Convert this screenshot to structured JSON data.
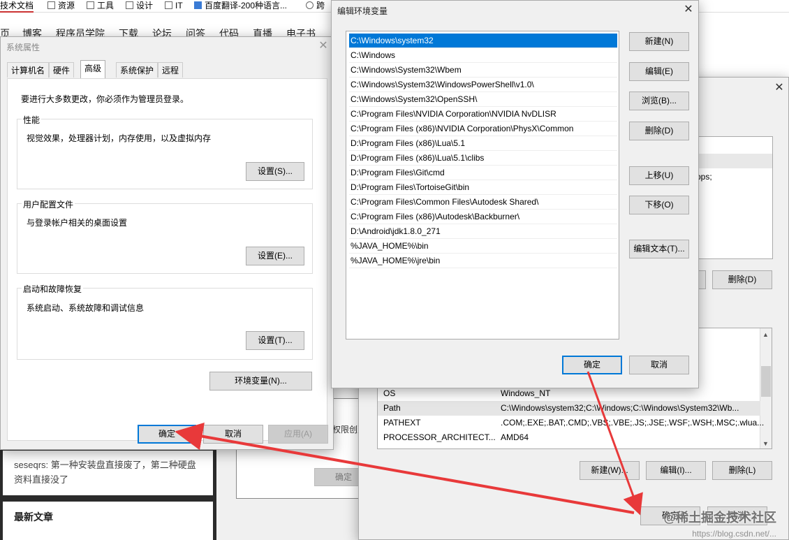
{
  "browser": {
    "bookmarks": [
      "技术文档",
      "资源",
      "工具",
      "设计",
      "IT",
      "百度翻译-200种语言...",
      "跨"
    ],
    "nav": [
      "页",
      "博客",
      "程序员学院",
      "下载",
      "论坛",
      "问答",
      "代码",
      "直播",
      "电子书"
    ],
    "comment": "seseqrs: 第一种安装盘直接废了，第二种硬盘资料直接没了",
    "latest_title": "最新文章",
    "mid_text": "权限创建",
    "mid_ok": "确定"
  },
  "sysprops": {
    "title": "系统属性",
    "tabs": [
      "计算机名",
      "硬件",
      "高级",
      "系统保护",
      "远程"
    ],
    "notice": "要进行大多数更改，你必须作为管理员登录。",
    "performance": {
      "title": "性能",
      "desc": "视觉效果，处理器计划，内存使用，以及虚拟内存",
      "btn": "设置(S)..."
    },
    "profiles": {
      "title": "用户配置文件",
      "desc": "与登录帐户相关的桌面设置",
      "btn": "设置(E)..."
    },
    "startup": {
      "title": "启动和故障恢复",
      "desc": "系统启动、系统故障和调试信息",
      "btn": "设置(T)..."
    },
    "envvars_btn": "环境变量(N)...",
    "ok": "确定",
    "cancel": "取消",
    "apply": "应用(A)"
  },
  "envvars": {
    "user_partial_text": "pps;",
    "user_delete": "删除(D)",
    "sys_rows": [
      {
        "name": "OS",
        "value": "Windows_NT"
      },
      {
        "name": "Path",
        "value": "C:\\Windows\\system32;C:\\Windows;C:\\Windows\\System32\\Wb..."
      },
      {
        "name": "PATHEXT",
        "value": ".COM;.EXE;.BAT;.CMD;.VBS;.VBE;.JS;.JSE;.WSF;.WSH;.MSC;.wlua..."
      },
      {
        "name": "PROCESSOR_ARCHITECT...",
        "value": "AMD64"
      }
    ],
    "sys_new": "新建(W)...",
    "sys_edit": "编辑(I)...",
    "sys_delete": "删除(L)",
    "ok": "确定",
    "cancel": "取消"
  },
  "editenv": {
    "title": "编辑环境变量",
    "paths": [
      "C:\\Windows\\system32",
      "C:\\Windows",
      "C:\\Windows\\System32\\Wbem",
      "C:\\Windows\\System32\\WindowsPowerShell\\v1.0\\",
      "C:\\Windows\\System32\\OpenSSH\\",
      "C:\\Program Files\\NVIDIA Corporation\\NVIDIA NvDLISR",
      "C:\\Program Files (x86)\\NVIDIA Corporation\\PhysX\\Common",
      "D:\\Program Files (x86)\\Lua\\5.1",
      "D:\\Program Files (x86)\\Lua\\5.1\\clibs",
      "D:\\Program Files\\Git\\cmd",
      "D:\\Program Files\\TortoiseGit\\bin",
      "C:\\Program Files\\Common Files\\Autodesk Shared\\",
      "C:\\Program Files (x86)\\Autodesk\\Backburner\\",
      "D:\\Android\\jdk1.8.0_271",
      "%JAVA_HOME%\\bin",
      "%JAVA_HOME%\\jre\\bin"
    ],
    "buttons": {
      "new": "新建(N)",
      "edit": "编辑(E)",
      "browse": "浏览(B)...",
      "delete": "删除(D)",
      "up": "上移(U)",
      "down": "下移(O)",
      "edit_text": "编辑文本(T)..."
    },
    "ok": "确定",
    "cancel": "取消"
  },
  "watermark": {
    "text": "@稀土掘金技术社区",
    "url": "https://blog.csdn.net/..."
  },
  "colors": {
    "selection": "#0078d7",
    "arrow": "#e8393a"
  }
}
